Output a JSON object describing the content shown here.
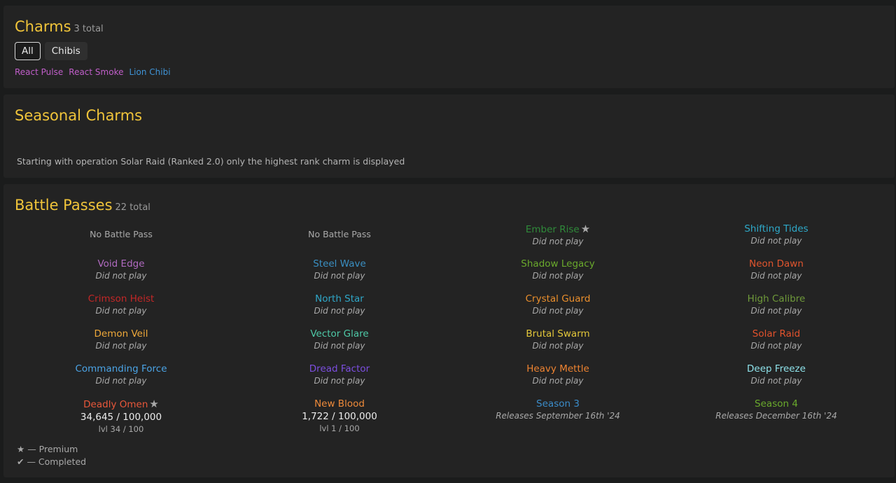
{
  "charms": {
    "title": "Charms",
    "count": "3 total",
    "filters": [
      "All",
      "Chibis"
    ],
    "items": [
      {
        "label": "React Pulse",
        "color": "#c05ec9"
      },
      {
        "label": "React Smoke",
        "color": "#c05ec9"
      },
      {
        "label": "Lion Chibi",
        "color": "#3f93d6"
      }
    ]
  },
  "seasonal": {
    "title": "Seasonal Charms",
    "note": "Starting with operation Solar Raid (Ranked 2.0) only the highest rank charm is displayed"
  },
  "battle_passes": {
    "title": "Battle Passes",
    "count": "22 total",
    "items": [
      {
        "type": "none",
        "text": "No Battle Pass"
      },
      {
        "type": "none",
        "text": "No Battle Pass"
      },
      {
        "type": "season",
        "name": "Ember Rise",
        "color": "#2f8a3a",
        "premium": true,
        "status": "Did not play"
      },
      {
        "type": "season",
        "name": "Shifting Tides",
        "color": "#2ea9c9",
        "premium": false,
        "status": "Did not play"
      },
      {
        "type": "season",
        "name": "Void Edge",
        "color": "#b06ac0",
        "premium": false,
        "status": "Did not play"
      },
      {
        "type": "season",
        "name": "Steel Wave",
        "color": "#3a8fc2",
        "premium": false,
        "status": "Did not play"
      },
      {
        "type": "season",
        "name": "Shadow Legacy",
        "color": "#6aaa2c",
        "premium": false,
        "status": "Did not play"
      },
      {
        "type": "season",
        "name": "Neon Dawn",
        "color": "#e0552e",
        "premium": false,
        "status": "Did not play"
      },
      {
        "type": "season",
        "name": "Crimson Heist",
        "color": "#c42727",
        "premium": false,
        "status": "Did not play"
      },
      {
        "type": "season",
        "name": "North Star",
        "color": "#2fa7c8",
        "premium": false,
        "status": "Did not play"
      },
      {
        "type": "season",
        "name": "Crystal Guard",
        "color": "#eb8f2c",
        "premium": false,
        "status": "Did not play"
      },
      {
        "type": "season",
        "name": "High Calibre",
        "color": "#6f9a3a",
        "premium": false,
        "status": "Did not play"
      },
      {
        "type": "season",
        "name": "Demon Veil",
        "color": "#efa93a",
        "premium": false,
        "status": "Did not play"
      },
      {
        "type": "season",
        "name": "Vector Glare",
        "color": "#4ec9a7",
        "premium": false,
        "status": "Did not play"
      },
      {
        "type": "season",
        "name": "Brutal Swarm",
        "color": "#e3c73a",
        "premium": false,
        "status": "Did not play"
      },
      {
        "type": "season",
        "name": "Solar Raid",
        "color": "#e2522c",
        "premium": false,
        "status": "Did not play"
      },
      {
        "type": "season",
        "name": "Commanding Force",
        "color": "#4ba4e6",
        "premium": false,
        "status": "Did not play"
      },
      {
        "type": "season",
        "name": "Dread Factor",
        "color": "#7c4ee0",
        "premium": false,
        "status": "Did not play"
      },
      {
        "type": "season",
        "name": "Heavy Mettle",
        "color": "#ee8331",
        "premium": false,
        "status": "Did not play"
      },
      {
        "type": "season",
        "name": "Deep Freeze",
        "color": "#8ee2ea",
        "premium": false,
        "status": "Did not play"
      },
      {
        "type": "progress",
        "name": "Deadly Omen",
        "color": "#e8573a",
        "premium": true,
        "progress": "34,645 / 100,000",
        "level": "lvl 34 / 100"
      },
      {
        "type": "progress",
        "name": "New Blood",
        "color": "#ee8a3a",
        "premium": false,
        "progress": "1,722 / 100,000",
        "level": "lvl 1 / 100"
      },
      {
        "type": "upcoming",
        "name": "Season 3",
        "color": "#3b8cc9",
        "release": "Releases September 16th '24"
      },
      {
        "type": "upcoming",
        "name": "Season 4",
        "color": "#6aaa2c",
        "release": "Releases December 16th '24"
      }
    ]
  },
  "legend": {
    "premium_glyph": "★",
    "premium_label": " — Premium",
    "completed_glyph": "✔",
    "completed_label": " — Completed"
  }
}
